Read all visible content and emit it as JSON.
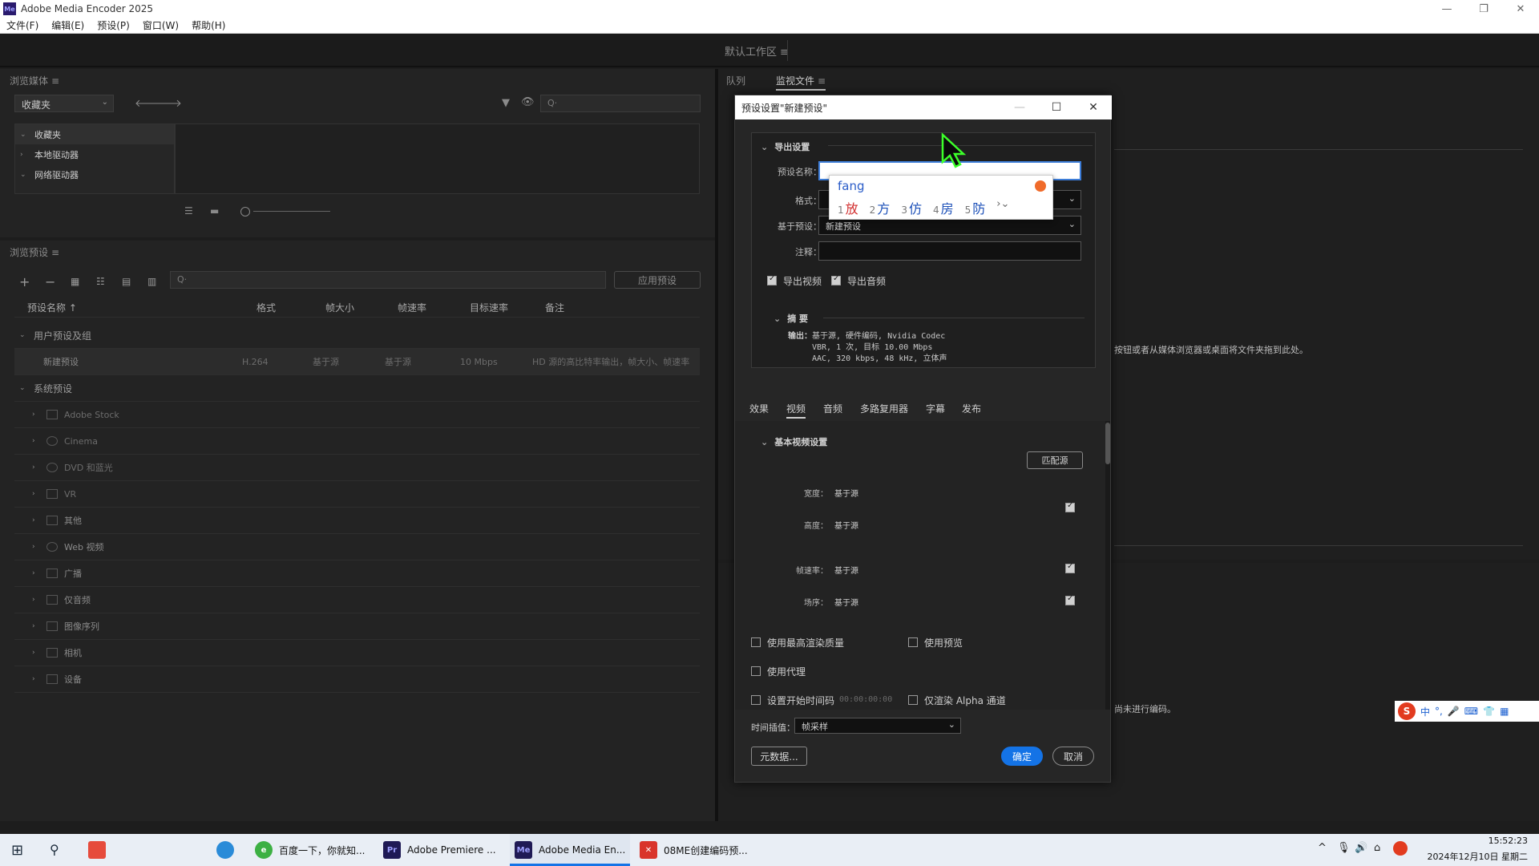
{
  "window": {
    "title": "Adobe Media Encoder 2025",
    "logo": "Me"
  },
  "menu": [
    "文件(F)",
    "编辑(E)",
    "预设(P)",
    "窗口(W)",
    "帮助(H)"
  ],
  "workspace": {
    "label": "默认工作区"
  },
  "media_browser": {
    "title": "浏览媒体",
    "location": "收藏夹",
    "tree": [
      "收藏夹",
      "本地驱动器",
      "网络驱动器"
    ]
  },
  "preset_browser": {
    "title": "浏览预设",
    "apply_label": "应用预设",
    "columns": [
      "预设名称 ↑",
      "格式",
      "帧大小",
      "帧速率",
      "目标速率",
      "备注"
    ],
    "user_group": "用户预设及组",
    "user_preset": {
      "name": "新建预设",
      "format": "H.264",
      "frame_size": "基于源",
      "frame_rate": "基于源",
      "target_rate": "10 Mbps",
      "note": "HD 源的高比特率输出，帧大小、帧速率"
    },
    "system_group": "系统预设",
    "system_items": [
      "Adobe Stock",
      "Cinema",
      "DVD 和蓝光",
      "VR",
      "其他",
      "Web 视频",
      "广播",
      "仅音频",
      "图像序列",
      "相机",
      "设备"
    ]
  },
  "right_panel": {
    "tabs": [
      "队列",
      "监视文件"
    ],
    "hint1": "按钮或者从媒体浏览器或桌面将文件夹拖到此处。",
    "hint2": "尚未进行编码。"
  },
  "dialog": {
    "title": "预设设置\"新建预设\"",
    "export_section": "导出设置",
    "preset_name_label": "预设名称：",
    "format_label": "格式：",
    "based_on_label": "基于预设：",
    "based_on_value": "新建预设",
    "comment_label": "注释：",
    "export_video": "导出视频",
    "export_audio": "导出音频",
    "summary_title": "摘 要",
    "summary_label": "输出：",
    "summary_lines": [
      "基于源, 硬件编码, Nvidia Codec",
      "VBR, 1 次, 目标 10.00 Mbps",
      "AAC, 320 kbps, 48 kHz, 立体声"
    ],
    "tabs": [
      "效果",
      "视频",
      "音频",
      "多路复用器",
      "字幕",
      "发布"
    ],
    "basic_video": "基本视频设置",
    "match_source": "匹配源",
    "width_label": "宽度：",
    "height_label": "高度：",
    "fps_label": "帧速率：",
    "field_label": "场序：",
    "source_value": "基于源",
    "use_max_quality": "使用最高渲染质量",
    "use_preview": "使用预览",
    "use_proxy": "使用代理",
    "set_start_tc": "设置开始时间码",
    "start_tc": "00:00:00:00",
    "alpha_only": "仅渲染 Alpha 通道",
    "time_interp_label": "时间插值：",
    "time_interp_value": "帧采样",
    "metadata_btn": "元数据...",
    "ok": "确定",
    "cancel": "取消"
  },
  "ime": {
    "composition": "fang",
    "candidates": [
      {
        "n": "1",
        "c": "放"
      },
      {
        "n": "2",
        "c": "方"
      },
      {
        "n": "3",
        "c": "仿"
      },
      {
        "n": "4",
        "c": "房"
      },
      {
        "n": "5",
        "c": "防"
      }
    ],
    "bar": [
      "中",
      "°,",
      "🎤",
      "⌨",
      "👕",
      "▦"
    ]
  },
  "taskbar": {
    "items": [
      "百度一下，你就知...",
      "Adobe Premiere ...",
      "Adobe Media En...",
      "08ME创建编码预..."
    ],
    "time": "15:52:23",
    "date": "2024年12月10日 星期二"
  },
  "colors": {
    "accent": "#1473e6",
    "ime_highlight": "#d23030"
  }
}
